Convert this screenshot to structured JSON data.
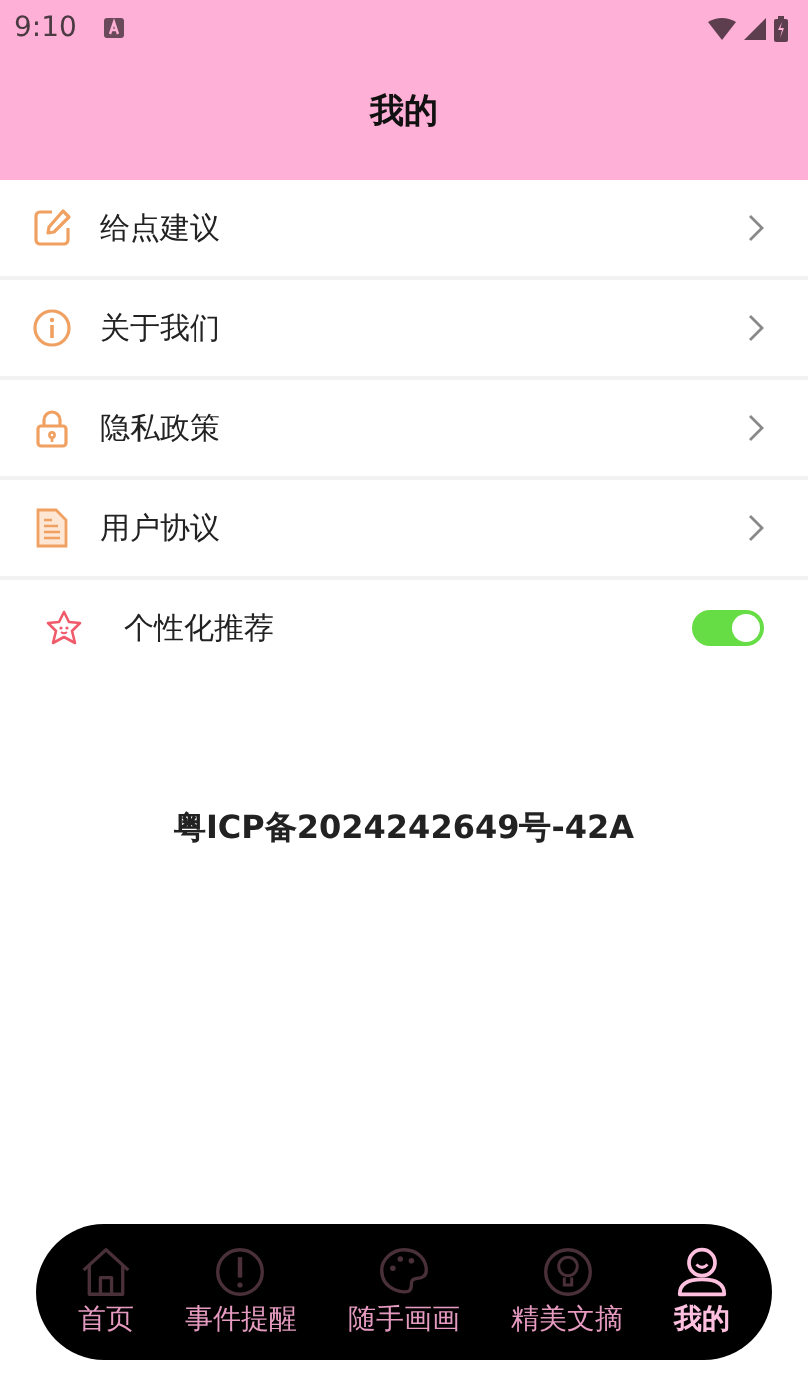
{
  "status_bar": {
    "time": "9:10"
  },
  "header": {
    "title": "我的"
  },
  "menu": [
    {
      "kind": "link",
      "label": "给点建议"
    },
    {
      "kind": "link",
      "label": "关于我们"
    },
    {
      "kind": "link",
      "label": "隐私政策"
    },
    {
      "kind": "link",
      "label": "用户协议"
    },
    {
      "kind": "toggle",
      "label": "个性化推荐",
      "on": true
    }
  ],
  "footer_text": "粤ICP备2024242649号-42A",
  "tabs": [
    {
      "label": "首页",
      "selected": false
    },
    {
      "label": "事件提醒",
      "selected": false
    },
    {
      "label": "随手画画",
      "selected": false
    },
    {
      "label": "精美文摘",
      "selected": false
    },
    {
      "label": "我的",
      "selected": true
    }
  ]
}
